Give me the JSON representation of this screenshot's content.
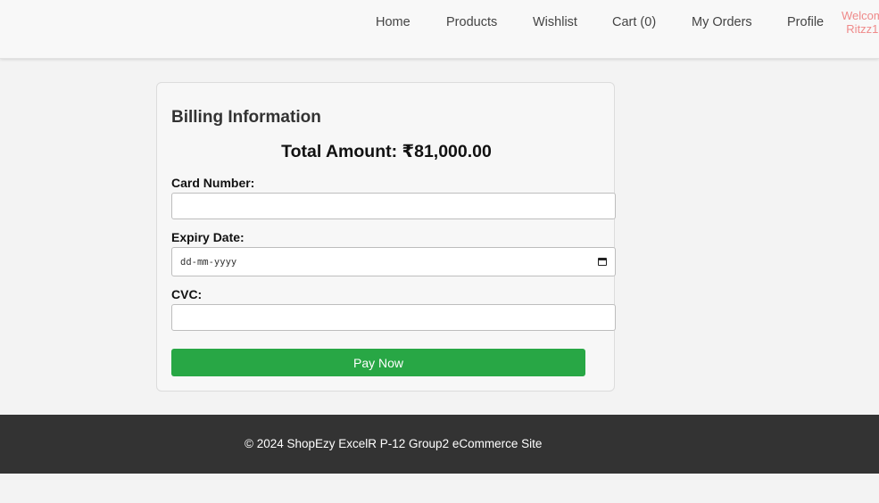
{
  "nav": {
    "links": [
      "Home",
      "Products",
      "Wishlist",
      "Cart (0)",
      "My Orders",
      "Profile"
    ],
    "welcome_line1": "Welcom",
    "welcome_line2": "Ritzz1"
  },
  "billing": {
    "title": "Billing Information",
    "total_label": "Total Amount: ₹81,000.00",
    "card_number_label": "Card Number:",
    "card_number_value": "",
    "expiry_label": "Expiry Date:",
    "expiry_placeholder": "dd-mm-yyyy",
    "cvc_label": "CVC:",
    "cvc_value": "",
    "pay_button": "Pay Now"
  },
  "footer": {
    "text": "© 2024 ShopEzy ExcelR P-12 Group2 eCommerce Site"
  },
  "colors": {
    "pay_button": "#28a745",
    "footer_bg": "#333333",
    "welcome_text": "#ef8a8a"
  },
  "icons": {
    "expiry_picker": "calendar-icon"
  }
}
